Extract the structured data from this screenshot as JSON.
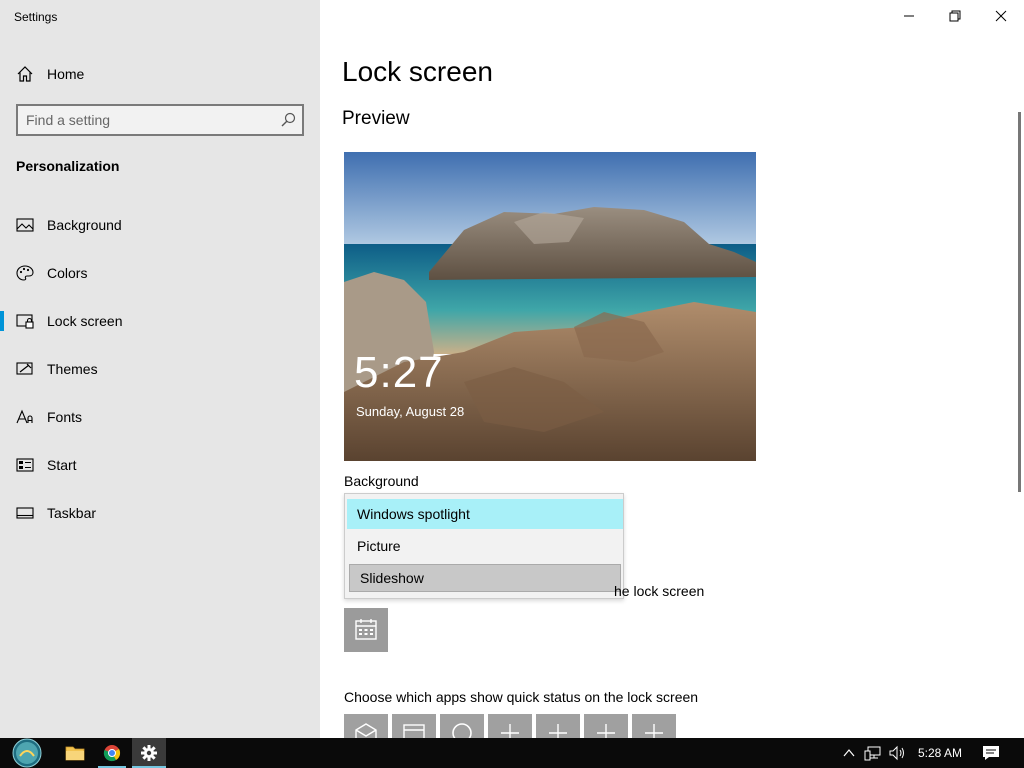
{
  "window": {
    "title": "Settings"
  },
  "sidebar": {
    "home_label": "Home",
    "search_placeholder": "Find a setting",
    "section_title": "Personalization",
    "items": [
      {
        "label": "Background",
        "icon": "picture-icon"
      },
      {
        "label": "Colors",
        "icon": "palette-icon"
      },
      {
        "label": "Lock screen",
        "icon": "lock-screen-icon",
        "active": true
      },
      {
        "label": "Themes",
        "icon": "themes-icon"
      },
      {
        "label": "Fonts",
        "icon": "fonts-icon"
      },
      {
        "label": "Start",
        "icon": "start-icon"
      },
      {
        "label": "Taskbar",
        "icon": "taskbar-icon"
      }
    ]
  },
  "main": {
    "page_title": "Lock screen",
    "preview_title": "Preview",
    "preview_time": "5:27",
    "preview_date": "Sunday, August 28",
    "background_label": "Background",
    "dropdown": {
      "options": [
        "Windows spotlight",
        "Picture",
        "Slideshow"
      ],
      "selected": "Windows spotlight",
      "hovered": "Slideshow"
    },
    "detailed_status_tail": "he lock screen",
    "quick_status_label": "Choose which apps show quick status on the lock screen"
  },
  "taskbar": {
    "time": "5:28 AM"
  },
  "colors": {
    "accent": "#0094d8",
    "dropdown_selected": "#a8f0f8",
    "sidebar_bg": "#e6e6e6"
  }
}
